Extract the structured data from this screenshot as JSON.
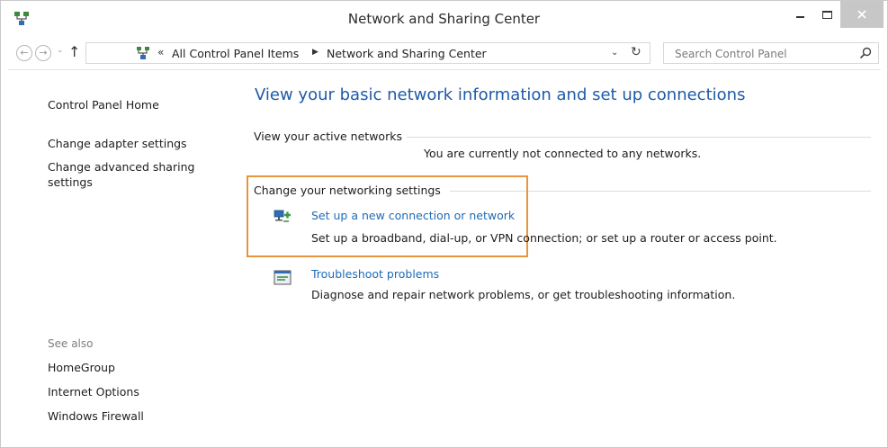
{
  "window": {
    "title": "Network and Sharing Center"
  },
  "nav": {
    "breadcrumbs": [
      "All Control Panel Items",
      "Network and Sharing Center"
    ],
    "search_placeholder": "Search Control Panel"
  },
  "sidebar": {
    "top_links": [
      {
        "label": "Control Panel Home"
      },
      {
        "label": "Change adapter settings"
      },
      {
        "label": "Change advanced sharing"
      },
      {
        "label": "settings"
      }
    ],
    "see_also_label": "See also",
    "see_also_links": [
      {
        "label": "HomeGroup"
      },
      {
        "label": "Internet Options"
      },
      {
        "label": "Windows Firewall"
      }
    ]
  },
  "main": {
    "title": "View your basic network information and set up connections",
    "active_networks_label": "View your active networks",
    "active_networks_status": "You are currently not connected to any networks.",
    "settings_label": "Change your networking settings",
    "tasks": [
      {
        "link": "Set up a new connection or network",
        "description": "Set up a broadband, dial-up, or VPN connection; or set up a router or access point.",
        "icon": "network-setup-icon"
      },
      {
        "link": "Troubleshoot problems",
        "description": "Diagnose and repair network problems, or get troubleshooting information.",
        "icon": "troubleshoot-icon"
      }
    ]
  },
  "colors": {
    "title_blue": "#1e5aa8",
    "link_blue": "#1e6bb8",
    "highlight_orange": "#e8963e"
  }
}
